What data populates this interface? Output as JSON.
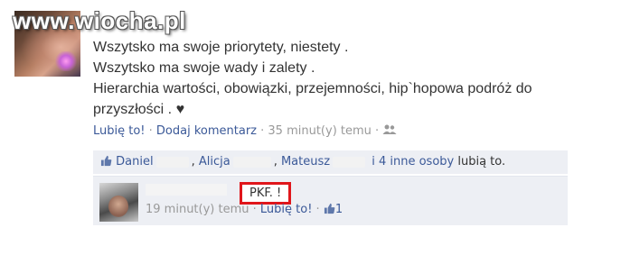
{
  "watermark": "www.wiocha.pl",
  "post": {
    "lines": [
      "Wszytsko ma swoje priorytety, niestety .",
      "Wszytsko ma swoje wady i zalety .",
      "Hierarchia wartości, obowiązki, przejemności, hip`hopowa podróż do",
      "przyszłości . ♥"
    ]
  },
  "meta": {
    "like": "Lubię to!",
    "sep1": " · ",
    "comment": "Dodaj komentarz",
    "sep2": " · ",
    "time": "35 minut(y) temu",
    "sep3": " · "
  },
  "likes": {
    "name1": "Daniel",
    "name2": "Alicja",
    "name3": "Mateusz",
    "others": "i 4 inne osoby",
    "suffix": " lubią to."
  },
  "comment": {
    "text": "PKF. !",
    "time": "19 minut(y) temu",
    "sep": " · ",
    "like": "Lubię to!",
    "sep2": " · ",
    "count": "1"
  },
  "colors": {
    "link": "#3b5998",
    "meta": "#999999",
    "highlight": "#e0161b",
    "panel": "#edeff4"
  }
}
